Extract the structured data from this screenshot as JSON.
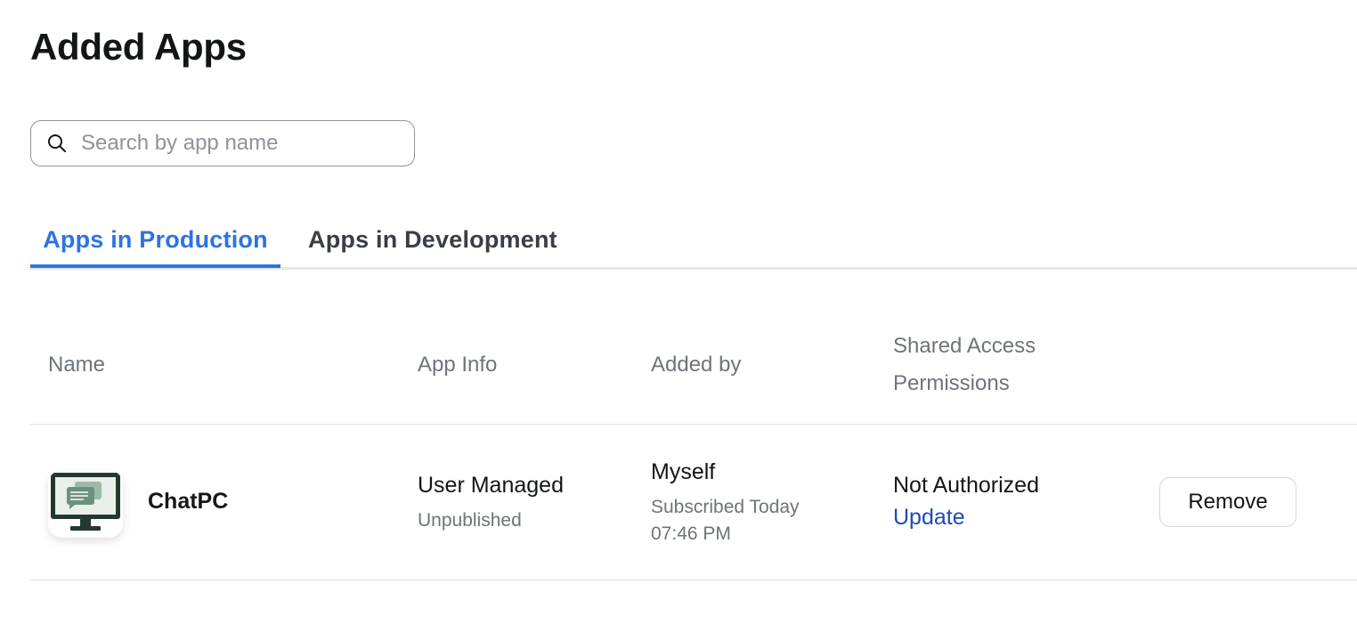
{
  "page": {
    "title": "Added Apps"
  },
  "search": {
    "placeholder": "Search by app name",
    "value": "",
    "icon": "search-icon"
  },
  "tabs": [
    {
      "label": "Apps in Production",
      "active": true
    },
    {
      "label": "Apps in Development",
      "active": false
    }
  ],
  "colors": {
    "accent": "#2d73e3",
    "link": "#1d4ab5",
    "app_icon_frame": "#23392f",
    "app_icon_screen": "#e9efe9",
    "app_icon_bubble": "#6d917f"
  },
  "table": {
    "headers": {
      "name": "Name",
      "app_info": "App Info",
      "added_by": "Added by",
      "shared_access": "Shared Access Permissions"
    },
    "rows": [
      {
        "icon": "computer-chat-icon",
        "name": "ChatPC",
        "app_info": "User Managed",
        "app_status": "Unpublished",
        "added_by": "Myself",
        "subscribed": "Subscribed Today 07:46 PM",
        "permission": "Not Authorized",
        "permission_action": "Update",
        "action": "Remove"
      }
    ]
  }
}
